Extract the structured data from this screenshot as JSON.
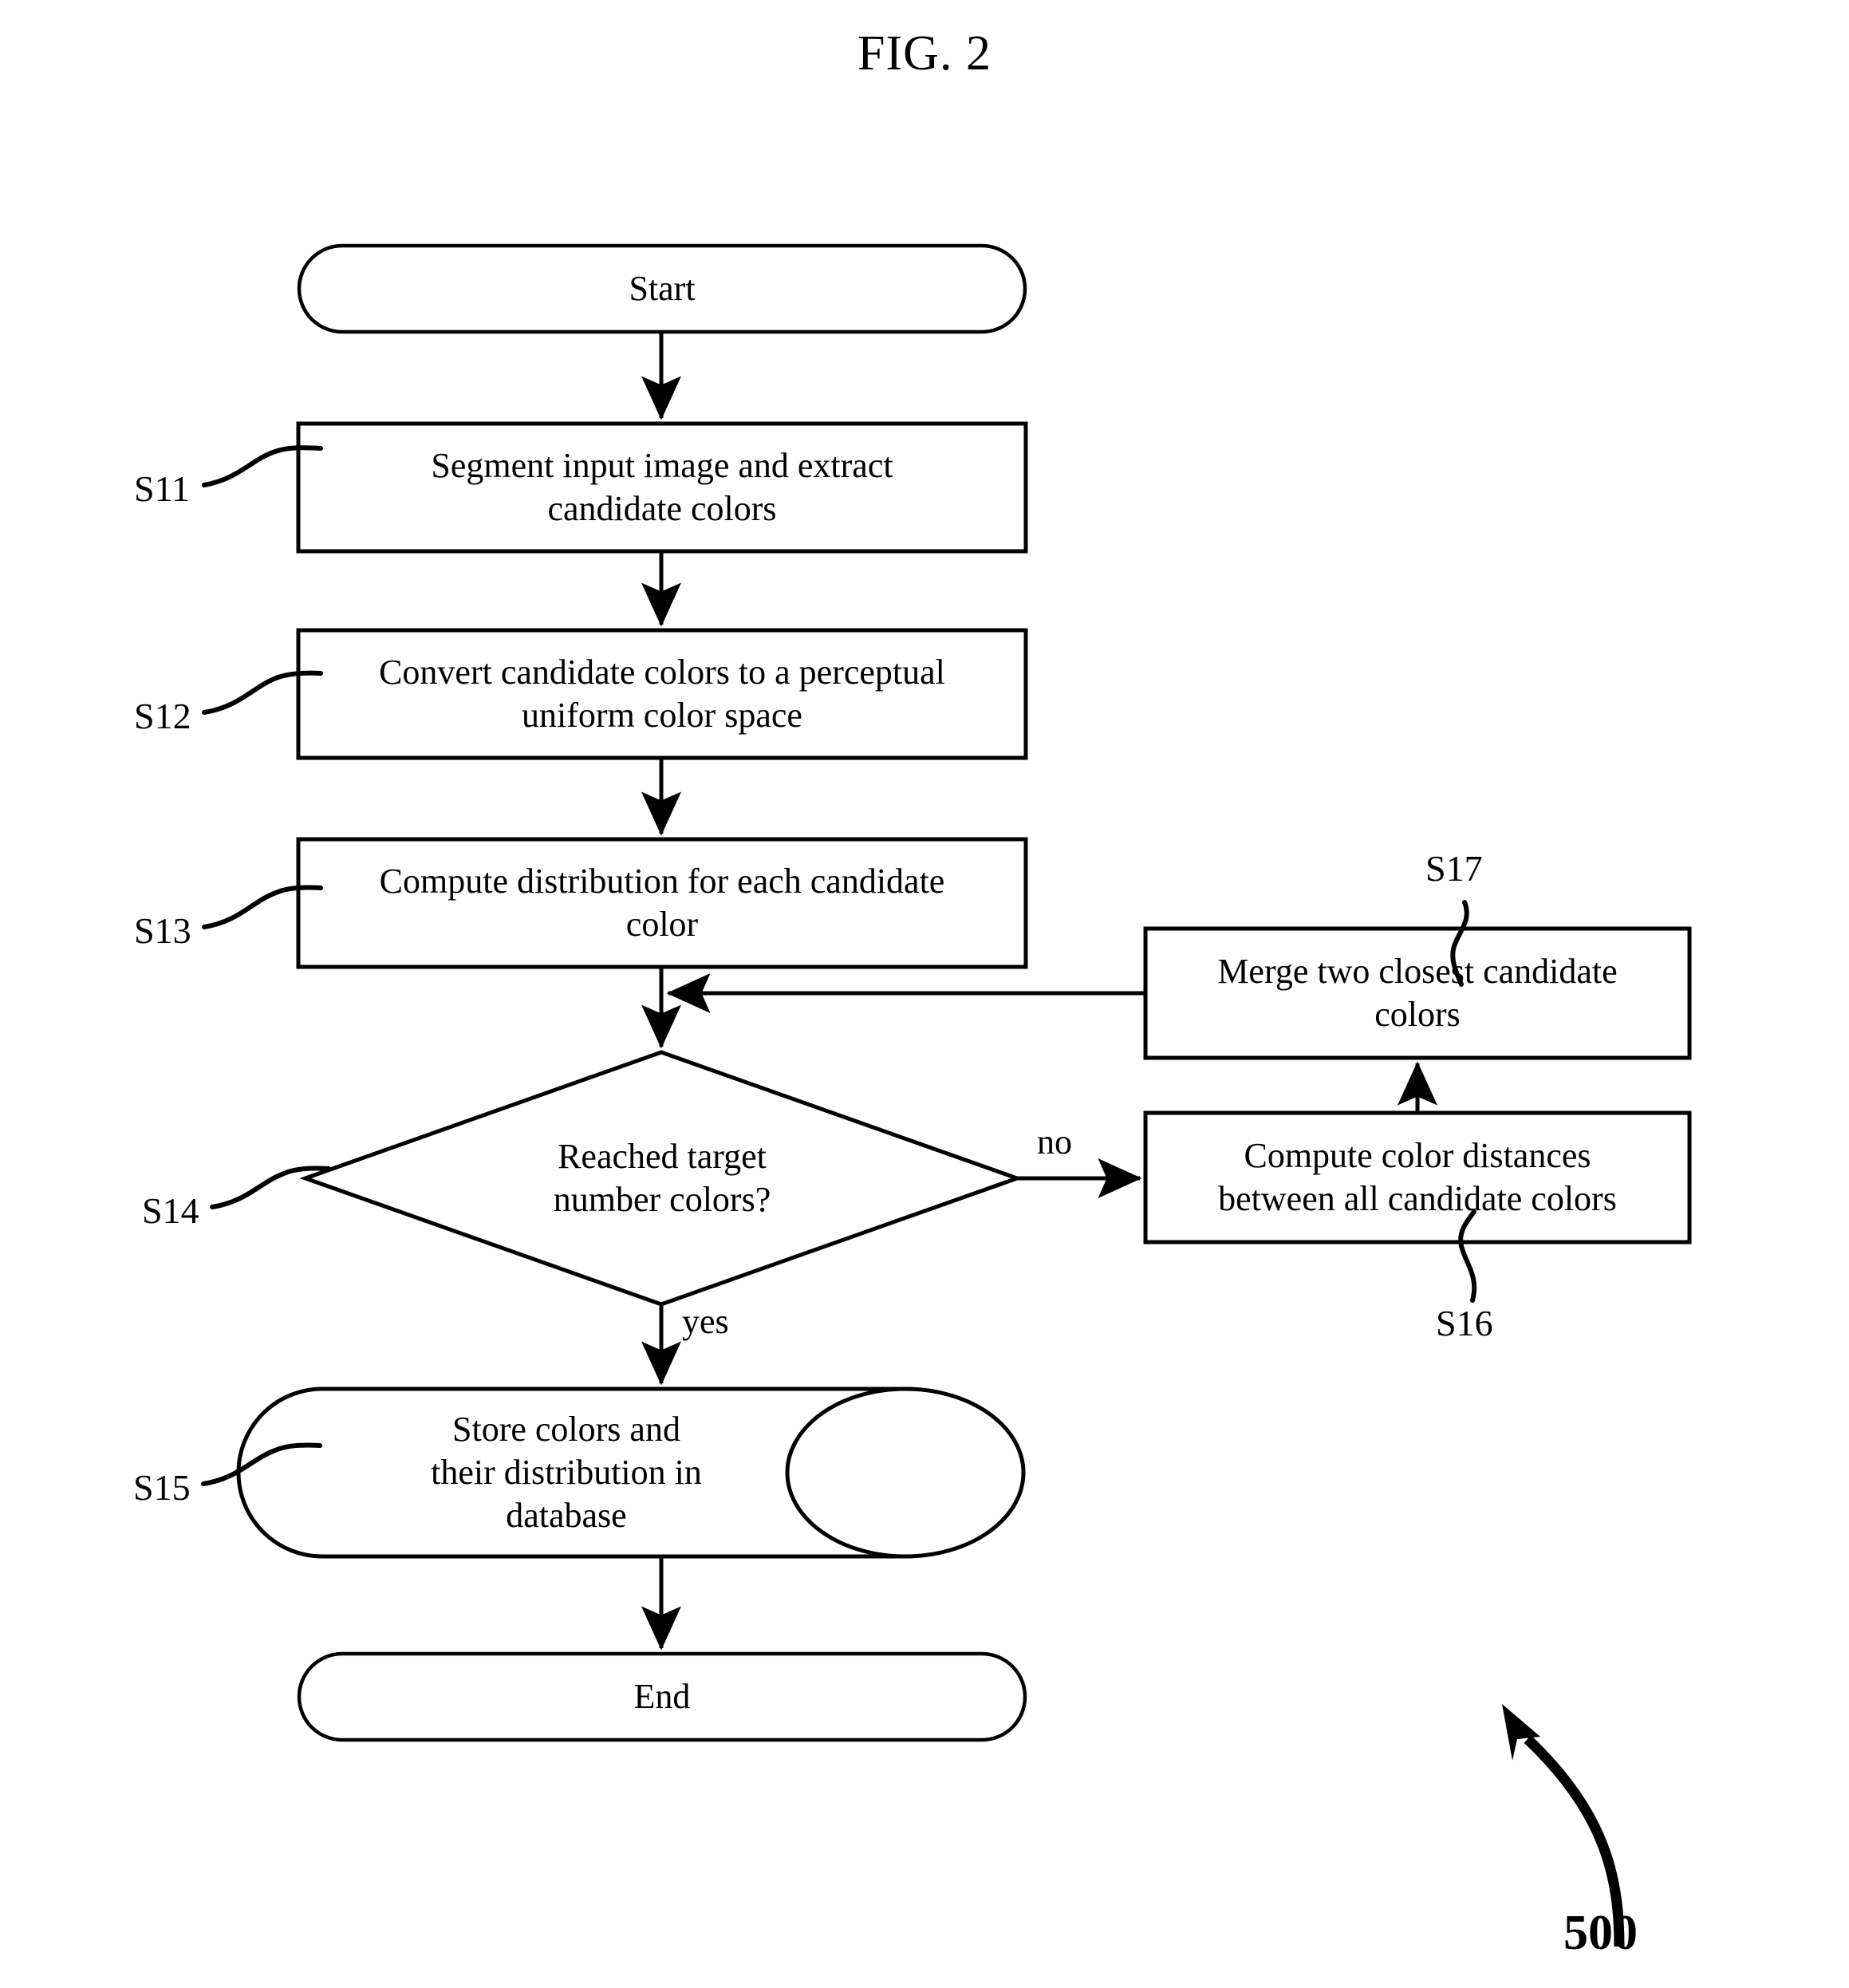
{
  "figure": {
    "title": "FIG. 2",
    "reference_numeral": "500"
  },
  "nodes": {
    "start": {
      "label": "Start",
      "shape": "stadium"
    },
    "s11": {
      "ref": "S11",
      "label": "Segment input image and extract\ncandidate colors",
      "shape": "process"
    },
    "s12": {
      "ref": "S12",
      "label": "Convert candidate colors to a perceptual\nuniform color space",
      "shape": "process"
    },
    "s13": {
      "ref": "S13",
      "label": "Compute distribution for each candidate\ncolor",
      "shape": "process"
    },
    "s14": {
      "ref": "S14",
      "label": "Reached target\nnumber colors?",
      "shape": "decision"
    },
    "s15": {
      "ref": "S15",
      "label": "Store colors and\ntheir distribution in\ndatabase",
      "shape": "database"
    },
    "s16": {
      "ref": "S16",
      "label": "Compute color distances\nbetween all candidate colors",
      "shape": "process"
    },
    "s17": {
      "ref": "S17",
      "label": "Merge two closest candidate\ncolors",
      "shape": "process"
    },
    "end": {
      "label": "End",
      "shape": "stadium"
    }
  },
  "edges": {
    "no_label": "no",
    "yes_label": "yes"
  },
  "colors": {
    "stroke": "#000000",
    "fill": "#ffffff",
    "text": "#000000"
  }
}
